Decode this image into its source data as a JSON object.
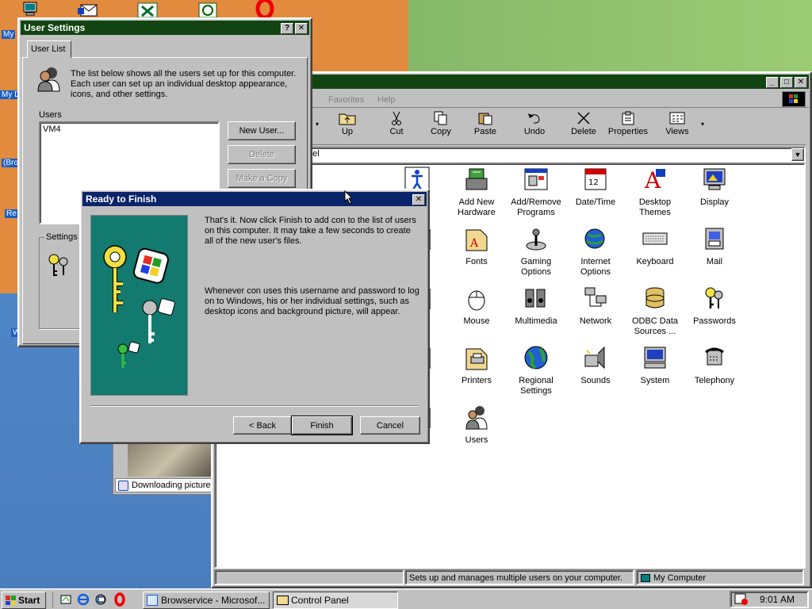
{
  "desktop": {
    "labels": [
      "My",
      "My D",
      "(Bro",
      "Re",
      "W"
    ]
  },
  "control_panel": {
    "menu": [
      "Favorites",
      "Help"
    ],
    "toolbar": [
      "Up",
      "Cut",
      "Copy",
      "Paste",
      "Undo",
      "Delete",
      "Properties",
      "Views"
    ],
    "address": "nel",
    "icons": [
      {
        "label": "bility\nns",
        "icon": "accessibility-icon"
      },
      {
        "label": "Add New\nHardware",
        "icon": "add-hardware-icon"
      },
      {
        "label": "Add/Remove\nPrograms",
        "icon": "add-remove-programs-icon"
      },
      {
        "label": "Date/Time",
        "icon": "date-time-icon"
      },
      {
        "label": "Desktop\nThemes",
        "icon": "desktop-themes-icon"
      },
      {
        "label": "Display",
        "icon": "display-icon"
      },
      {
        "label": "ast",
        "icon": "partial-icon"
      },
      {
        "label": "Fonts",
        "icon": "fonts-icon"
      },
      {
        "label": "Gaming\nOptions",
        "icon": "gaming-options-icon"
      },
      {
        "label": "Internet\nOptions",
        "icon": "internet-options-icon"
      },
      {
        "label": "Keyboard",
        "icon": "keyboard-icon"
      },
      {
        "label": "Mail",
        "icon": "mail-icon"
      },
      {
        "label": "ms",
        "icon": "partial-icon"
      },
      {
        "label": "Mouse",
        "icon": "mouse-icon"
      },
      {
        "label": "Multimedia",
        "icon": "multimedia-icon"
      },
      {
        "label": "Network",
        "icon": "network-icon"
      },
      {
        "label": "ODBC Data\nSources ...",
        "icon": "odbc-icon"
      },
      {
        "label": "Passwords",
        "icon": "passwords-icon"
      },
      {
        "label": "er\nment",
        "icon": "partial-icon"
      },
      {
        "label": "Printers",
        "icon": "printers-icon"
      },
      {
        "label": "Regional\nSettings",
        "icon": "regional-settings-icon"
      },
      {
        "label": "Sounds",
        "icon": "sounds-icon"
      },
      {
        "label": "System",
        "icon": "system-icon"
      },
      {
        "label": "Telephony",
        "icon": "telephony-icon"
      },
      {
        "label": "UI",
        "icon": "partial-icon"
      },
      {
        "label": "Users",
        "icon": "users-icon"
      }
    ],
    "status_text": "Sets up and manages multiple users on your computer.",
    "status_zone": "My Computer"
  },
  "browser_popup": {
    "status": "Downloading picture"
  },
  "user_settings": {
    "title": "User Settings",
    "help_glyph": "?",
    "close_glyph": "✕",
    "tab": "User List",
    "description": "The list below shows all the users set up for this computer. Each user can set up an individual desktop appearance, icons, and other settings.",
    "users_label": "Users",
    "users": [
      "VM4"
    ],
    "new_user": "New User...",
    "delete": "Delete",
    "make_copy": "Make a Copy",
    "settings_group": "Settings f"
  },
  "wizard": {
    "title": "Ready to Finish",
    "para1": "That's it. Now click Finish to add con to the list of users on this computer. It may take a few seconds to create all of the new user's files.",
    "para2": "Whenever con uses this username and password to log on to Windows, his or her individual settings, such as desktop icons and background picture, will appear.",
    "back": "< Back",
    "finish": "Finish",
    "cancel": "Cancel"
  },
  "taskbar": {
    "start": "Start",
    "tasks": [
      {
        "label": "Browservice - Microsof...",
        "active": false
      },
      {
        "label": "Control Panel",
        "active": true
      }
    ],
    "clock": "9:01 AM"
  }
}
